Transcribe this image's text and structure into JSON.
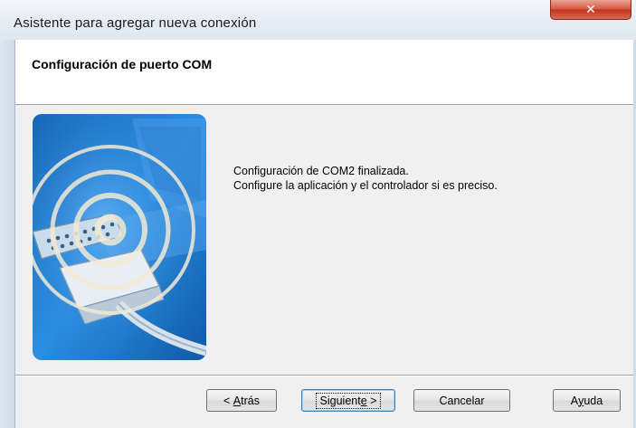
{
  "window": {
    "title": "Asistente para agregar nueva conexión",
    "close_symbol": "✕"
  },
  "header": {
    "title": "Configuración de puerto COM"
  },
  "message": {
    "line1": "Configuración de COM2 finalizada.",
    "line2": "Configure la aplicación y el controlador si es preciso."
  },
  "buttons": {
    "back_prefix": "< ",
    "back_mnemonic": "A",
    "back_rest": "trás",
    "next_mnemonic": "Siguient",
    "next_underlined": "e",
    "next_suffix": " >",
    "cancel": "Cancelar",
    "help_mnemonic": "y",
    "help_prefix": "A",
    "help_rest": "uda"
  },
  "illustration_icon": "serial-port-connection-icon",
  "colors": {
    "titlebar": "#e3ebf3",
    "close": "#c4331d",
    "illustration_blue": "#1f7fd0",
    "focus_border": "#3c7fb1"
  }
}
